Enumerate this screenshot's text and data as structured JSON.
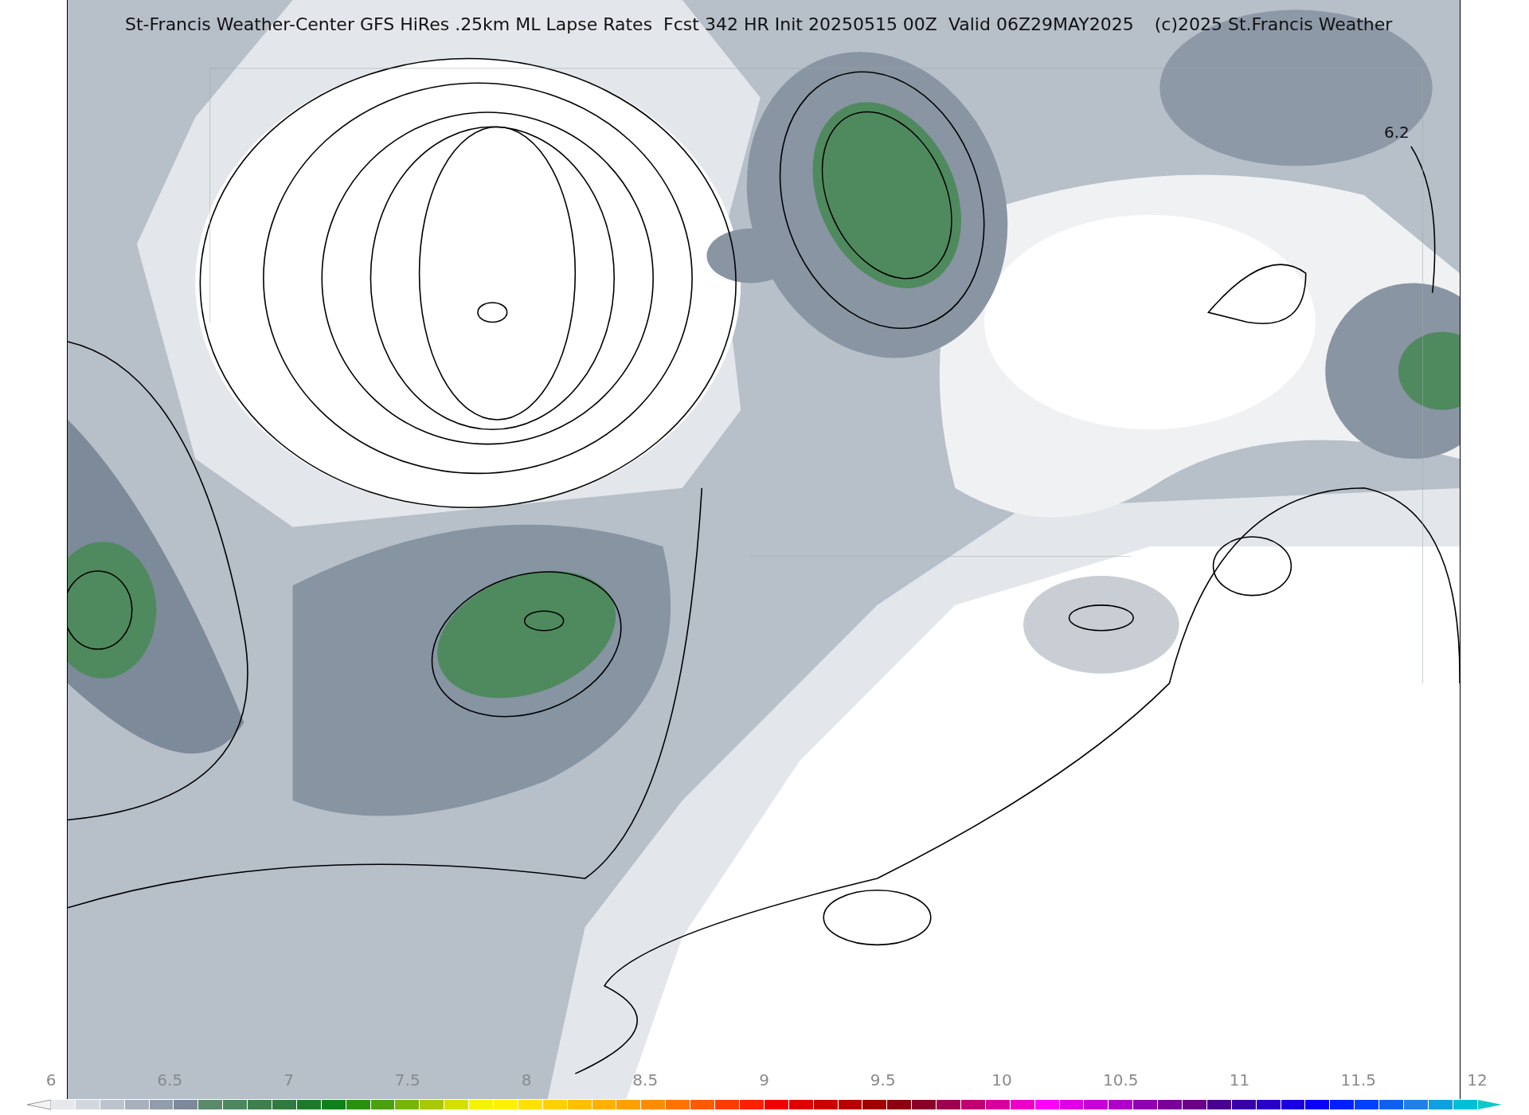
{
  "title": "St-Francis Weather-Center GFS HiRes .25km ML Lapse Rates  Fcst 342 HR Init 20250515 00Z  Valid 06Z29MAY2025",
  "copyright": "(c)2025 St.Francis Weather",
  "map": {
    "contour_labels": [
      "6.2"
    ]
  },
  "colorbar": {
    "ticks": [
      "6",
      "6.5",
      "7",
      "7.5",
      "8",
      "8.5",
      "9",
      "9.5",
      "10",
      "10.5",
      "11",
      "11.5",
      "12"
    ]
  }
}
